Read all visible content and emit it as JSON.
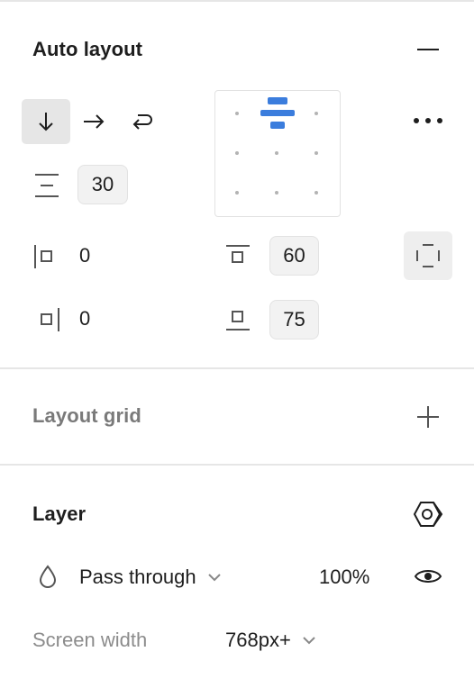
{
  "auto_layout": {
    "title": "Auto layout",
    "remove_icon": "minus-icon",
    "direction_buttons": [
      {
        "name": "vertical",
        "icon": "arrow-down-icon",
        "active": true
      },
      {
        "name": "horizontal",
        "icon": "arrow-right-icon",
        "active": false
      },
      {
        "name": "wrap",
        "icon": "wrap-icon",
        "active": false
      }
    ],
    "gap_icon": "vertical-gap-icon",
    "gap_value": "30",
    "alignment": "top-center",
    "more_icon": "more-options-icon",
    "padding_left": "0",
    "padding_right": "0",
    "padding_top": "60",
    "padding_bottom": "75",
    "clip_content_icon": "clip-content-icon"
  },
  "layout_grid": {
    "title": "Layout grid",
    "add_icon": "plus-icon"
  },
  "layer": {
    "title": "Layer",
    "mode_icon": "hexagon-mask-icon",
    "blend_icon": "droplet-icon",
    "blend_mode": "Pass through",
    "opacity": "100%",
    "visibility_icon": "eye-icon",
    "screen_width_label": "Screen width",
    "screen_width_value": "768px+"
  },
  "colors": {
    "accent": "#3b7ddd",
    "divider": "#e6e6e6",
    "muted_text": "#8c8c8c"
  }
}
